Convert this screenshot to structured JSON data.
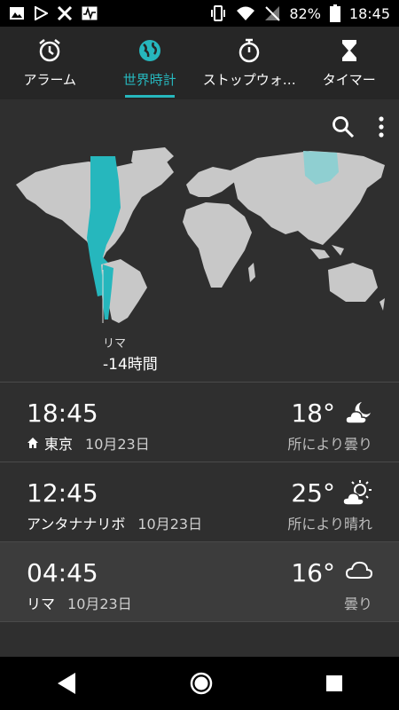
{
  "status_bar": {
    "battery": "82%",
    "time": "18:45"
  },
  "tabs": [
    {
      "label": "アラーム",
      "icon": "alarm-clock-icon"
    },
    {
      "label": "世界時計",
      "icon": "globe-icon",
      "active": true
    },
    {
      "label": "ストップウォ…",
      "icon": "stopwatch-icon"
    },
    {
      "label": "タイマー",
      "icon": "hourglass-icon"
    }
  ],
  "map": {
    "selected_city": "リマ",
    "time_difference": "-14時間"
  },
  "clocks": [
    {
      "time": "18:45",
      "city": "東京",
      "date": "10月23日",
      "home": true,
      "temperature": "18°",
      "condition": "所により曇り",
      "weather_icon": "partly-cloudy-night-icon"
    },
    {
      "time": "12:45",
      "city": "アンタナナリボ",
      "date": "10月23日",
      "temperature": "25°",
      "condition": "所により晴れ",
      "weather_icon": "partly-sunny-icon"
    },
    {
      "time": "04:45",
      "city": "リマ",
      "date": "10月23日",
      "temperature": "16°",
      "condition": "曇り",
      "weather_icon": "cloud-icon"
    }
  ],
  "colors": {
    "accent": "#26b7bd",
    "background": "#2f2f2f",
    "tab_bar": "#262626"
  }
}
